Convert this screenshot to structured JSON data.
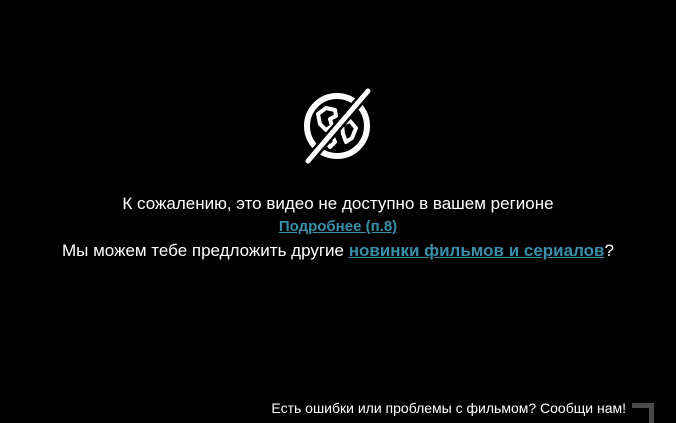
{
  "player": {
    "icon": "region-blocked-globe-icon",
    "message": "К сожалению, это видео не доступно в вашем регионе",
    "more_link": "Подробнее (п.8)",
    "offer_prefix": "Мы можем тебе предложить другие ",
    "offer_link": "новинки фильмов и сериалов",
    "offer_suffix": "?",
    "report_link": "Есть ошибки или проблемы с фильмом? Сообщи нам!",
    "corner_icon": "corner-bracket-icon"
  },
  "colors": {
    "background": "#000000",
    "text": "#ffffff",
    "link": "#3a8fa8"
  }
}
